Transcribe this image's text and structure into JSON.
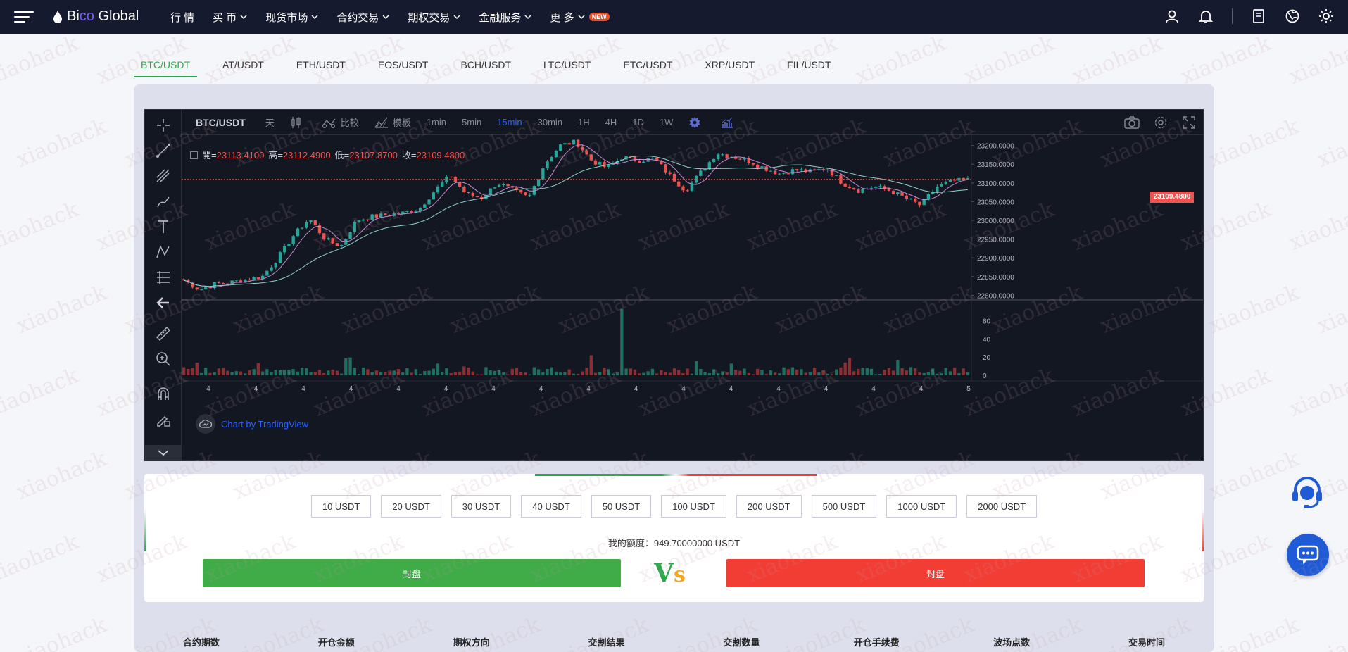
{
  "header": {
    "logo_prefix": "Bi",
    "logo_mid": "co",
    "logo_suffix": " Global",
    "nav": [
      {
        "label": "行 情",
        "dropdown": false
      },
      {
        "label": "买 币",
        "dropdown": true
      },
      {
        "label": "现货市场",
        "dropdown": true
      },
      {
        "label": "合约交易",
        "dropdown": true
      },
      {
        "label": "期权交易",
        "dropdown": true
      },
      {
        "label": "金融服务",
        "dropdown": true
      },
      {
        "label": "更 多",
        "dropdown": true,
        "badge": "NEW"
      }
    ],
    "icons": [
      "user-icon",
      "bell-icon",
      "document-icon",
      "globe-icon",
      "sun-icon"
    ]
  },
  "pair_tabs": [
    "BTC/USDT",
    "AT/USDT",
    "ETH/USDT",
    "EOS/USDT",
    "BCH/USDT",
    "LTC/USDT",
    "ETC/USDT",
    "XRP/USDT",
    "FIL/USDT"
  ],
  "active_pair_index": 0,
  "chart": {
    "symbol": "BTC/USDT",
    "day_label": "天",
    "compare_label": "比較",
    "template_label": "模板",
    "intervals": [
      "1min",
      "5min",
      "15min",
      "30min",
      "1H",
      "4H",
      "1D",
      "1W"
    ],
    "active_interval": "15min",
    "ohlc": {
      "open_label": "開=",
      "open": "23113.4100",
      "high_label": "高=",
      "high": "23112.4900",
      "low_label": "低=",
      "low": "23107.8700",
      "close_label": "收=",
      "close": "23109.4800"
    },
    "current_price": "23109.4800",
    "credit": "Chart by TradingView",
    "price_ticks": [
      "23200.0000",
      "23150.0000",
      "23100.0000",
      "23050.0000",
      "23000.0000",
      "22950.0000",
      "22900.0000",
      "22850.0000",
      "22800.0000"
    ],
    "volume_ticks": [
      "60",
      "40",
      "20",
      "0"
    ],
    "time_ticks": [
      "4",
      "4",
      "4",
      "4",
      "4",
      "4",
      "4",
      "4",
      "4",
      "4",
      "4",
      "4",
      "4",
      "4",
      "4",
      "4",
      "5"
    ]
  },
  "chart_data": {
    "type": "candlestick",
    "symbol": "BTC/USDT",
    "interval": "15min",
    "ylim": [
      22780,
      23220
    ],
    "volume_ylim": [
      0,
      75
    ],
    "close_path": [
      22840,
      22815,
      22830,
      22835,
      22842,
      22850,
      22900,
      22960,
      23005,
      22950,
      22930,
      23000,
      23010,
      23015,
      23020,
      23030,
      23080,
      23120,
      23070,
      23060,
      23100,
      23080,
      23060,
      23150,
      23200,
      23210,
      23160,
      23140,
      23170,
      23160,
      23165,
      23120,
      23080,
      23130,
      23180,
      23170,
      23160,
      23140,
      23125,
      23135,
      23130,
      23140,
      23100,
      23080,
      23090,
      23080,
      23060,
      23040,
      23090,
      23105,
      23108
    ]
  },
  "order": {
    "amounts": [
      "10 USDT",
      "20 USDT",
      "30 USDT",
      "40 USDT",
      "50 USDT",
      "100 USDT",
      "200 USDT",
      "500 USDT",
      "1000 USDT",
      "2000 USDT"
    ],
    "quota_label": "我的额度：",
    "quota_value": "949.70000000 USDT",
    "long_label": "封盘",
    "short_label": "封盘",
    "vs_v": "V",
    "vs_s": "s",
    "long_color": "#3fac48",
    "short_color": "#f23d35"
  },
  "table_headers": [
    "合约期数",
    "开仓金额",
    "期权方向",
    "交割结果",
    "交割数量",
    "开仓手续费",
    "波场点数",
    "交易时间"
  ],
  "watermark": "xiaohack"
}
